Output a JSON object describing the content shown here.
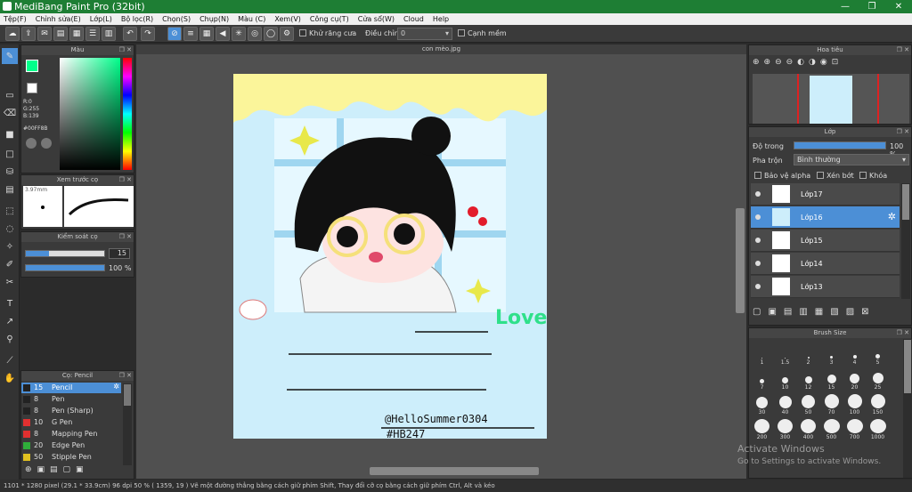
{
  "window": {
    "title": "MediBang Paint Pro (32bit)",
    "min": "—",
    "max": "❐",
    "close": "✕"
  },
  "menu": [
    "Tệp(F)",
    "Chỉnh sửa(E)",
    "Lớp(L)",
    "Bộ lọc(R)",
    "Chọn(S)",
    "Chụp(N)",
    "Màu (C)",
    "Xem(V)",
    "Công cụ(T)",
    "Cửa sổ(W)",
    "Cloud",
    "Help"
  ],
  "toolbar": {
    "antialias_label": "Khử răng cưa",
    "adjust_label": "Điều chỉnh",
    "adjust_value": "0",
    "edge_label": "Cạnh mềm"
  },
  "color_panel": {
    "title": "Màu",
    "r": "R:0",
    "g": "G:255",
    "b": "B:139",
    "hex": "#00FF8B",
    "accent": "#00ff8b"
  },
  "brush_preview": {
    "title": "Xem trước cọ",
    "size": "3.97mm"
  },
  "brush_control": {
    "title": "Kiểm soát cọ",
    "size_value": "15",
    "opacity_value": "100 %"
  },
  "brush_list": {
    "title": "Cọ: Pencil",
    "items": [
      {
        "size": "15",
        "name": "Pencil",
        "color": "#222222"
      },
      {
        "size": "8",
        "name": "Pen",
        "color": "#222222"
      },
      {
        "size": "8",
        "name": "Pen (Sharp)",
        "color": "#222222"
      },
      {
        "size": "10",
        "name": "G Pen",
        "color": "#e03030"
      },
      {
        "size": "8",
        "name": "Mapping Pen",
        "color": "#e03030"
      },
      {
        "size": "20",
        "name": "Edge Pen",
        "color": "#2fae3a"
      },
      {
        "size": "50",
        "name": "Stipple Pen",
        "color": "#e0c020"
      }
    ]
  },
  "canvas": {
    "tab": "con mèo.jpg",
    "signature": "@HelloSummer0304",
    "hashtag": "#HB247",
    "love": "Love"
  },
  "navigator": {
    "title": "Hoa tiêu"
  },
  "layer_panel": {
    "title": "Lớp",
    "opacity_label": "Độ trong",
    "opacity_value": "100 %",
    "blend_label": "Pha trộn",
    "blend_value": "Bình thường",
    "protect_alpha": "Bảo vệ alpha",
    "clipping": "Xén bớt",
    "lock": "Khóa",
    "layers": [
      {
        "name": "Lớp17"
      },
      {
        "name": "Lớp16"
      },
      {
        "name": "Lớp15"
      },
      {
        "name": "Lớp14"
      },
      {
        "name": "Lớp13"
      }
    ]
  },
  "brush_size": {
    "title": "Brush Size",
    "sizes": [
      "1",
      "1.5",
      "2",
      "3",
      "4",
      "5",
      "7",
      "10",
      "12",
      "15",
      "20",
      "25",
      "30",
      "40",
      "50",
      "70",
      "100",
      "150",
      "200",
      "300",
      "400",
      "500",
      "700",
      "1000"
    ]
  },
  "status": {
    "text": "1101 * 1280 pixel   (29.1 * 33.9cm)   96 dpi   50 %   ( 1359, 19 )   Vẽ một đường thẳng bằng cách giữ phím Shift, Thay đổi cỡ cọ bằng cách giữ phím Ctrl, Alt và kéo"
  },
  "watermark": {
    "line1": "Activate Windows",
    "line2": "Go to Settings to activate Windows."
  }
}
